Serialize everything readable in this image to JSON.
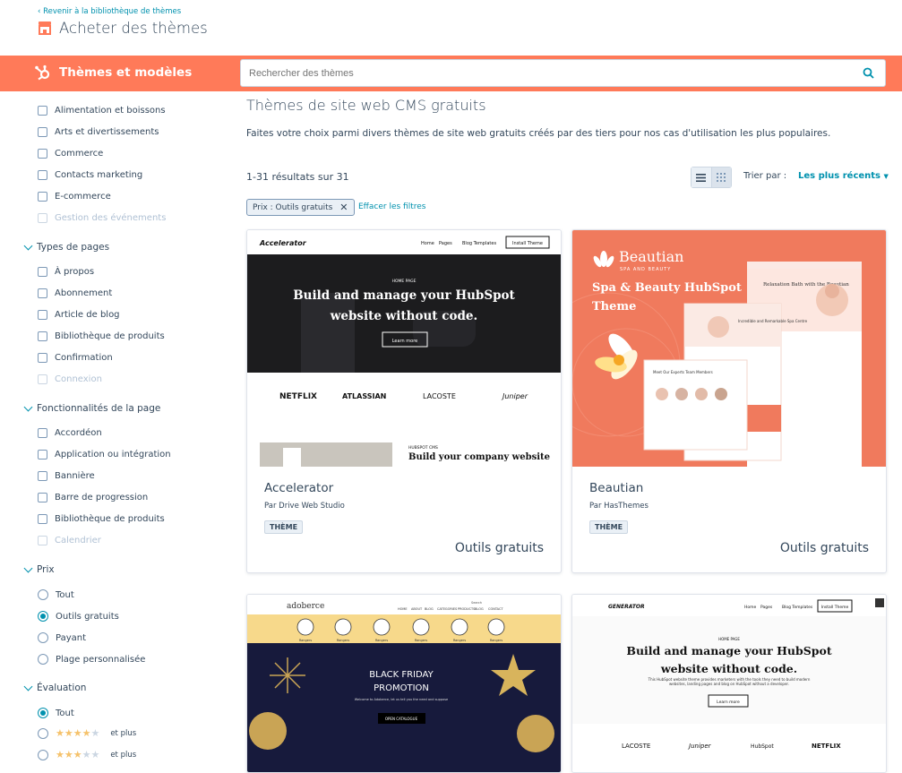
{
  "header": {
    "back_link": "Revenir à la bibliothèque de thèmes",
    "title": "Acheter des thèmes"
  },
  "band": {
    "title": "Thèmes et modèles"
  },
  "search": {
    "placeholder": "Rechercher des thèmes"
  },
  "sidebar": {
    "categories": [
      {
        "label": "Alimentation et boissons",
        "disabled": false
      },
      {
        "label": "Arts et divertissements",
        "disabled": false
      },
      {
        "label": "Commerce",
        "disabled": false
      },
      {
        "label": "Contacts marketing",
        "disabled": false
      },
      {
        "label": "E-commerce",
        "disabled": false
      },
      {
        "label": "Gestion des événements",
        "disabled": true
      }
    ],
    "page_types_title": "Types de pages",
    "page_types": [
      "À propos",
      "Abonnement",
      "Article de blog",
      "Bibliothèque de produits",
      "Confirmation",
      "Connexion"
    ],
    "features_title": "Fonctionnalités de la page",
    "features": [
      "Accordéon",
      "Application ou intégration",
      "Bannière",
      "Barre de progression",
      "Bibliothèque de produits",
      "Calendrier"
    ],
    "price_title": "Prix",
    "price_options": [
      "Tout",
      "Outils gratuits",
      "Payant",
      "Plage personnalisée"
    ],
    "price_selected": 1,
    "rating_title": "Évaluation",
    "rating_all": "Tout",
    "rating_suffix": "et plus",
    "rating_rows": [
      4,
      3
    ]
  },
  "main": {
    "title": "Thèmes de site web CMS gratuits",
    "description": "Faites votre choix parmi divers thèmes de site web gratuits créés par des tiers pour nos cas d'utilisation les plus populaires.",
    "results": "1-31 résultats sur 31",
    "sort_label": "Trier par :",
    "sort_value": "Les plus récents",
    "filter_chip": "Prix : Outils gratuits",
    "clear_filters": "Effacer les filtres"
  },
  "cards": [
    {
      "name": "Accelerator",
      "author": "Par Drive Web Studio",
      "tag": "THÈME",
      "price": "Outils gratuits",
      "thumb": {
        "logo": "Accelerator",
        "nav": [
          "Home",
          "Pages",
          "Blog Templates"
        ],
        "cta": "Install Theme",
        "eyebrow": "HOME PAGE",
        "headline1": "Build and manage your HubSpot",
        "headline2": "website without code.",
        "button": "Learn more",
        "brands": [
          "NETFLIX",
          "ATLASSIAN",
          "LACOSTE",
          "Juniper"
        ],
        "sub_eyebrow": "HUBSPOT CMS",
        "sub_headline": "Build your company website"
      }
    },
    {
      "name": "Beautian",
      "author": "Par HasThemes",
      "tag": "THÈME",
      "price": "Outils gratuits",
      "thumb": {
        "logo": "Beautian",
        "logo_sub": "SPA AND BEAUTY",
        "headline1": "Spa & Beauty HubSpot",
        "headline2": "Theme",
        "mock1": "Relaxation Bath with the Beautian",
        "mock2": "Meet Our Experts Team Members",
        "mock3": "Incredible and Remarkable Spa Centre"
      }
    },
    {
      "name": "",
      "author": "",
      "tag": "",
      "price": "",
      "thumb": {
        "logo": "adoberce",
        "nav": [
          "HOME",
          "ABOUT",
          "BLOG",
          "CATEGORIES",
          "PRODUCTS",
          "BLOG",
          "CONTACT"
        ],
        "search": "Search",
        "icon_label": "Rangers",
        "headline1": "BLACK FRIDAY",
        "headline2": "PROMOTION",
        "subtitle": "Welcome to Adoberce, let us tell you the need and suppose",
        "button": "OPEN CATALOGUE"
      }
    },
    {
      "name": "",
      "author": "",
      "tag": "",
      "price": "",
      "thumb": {
        "logo": "GENERATOR",
        "nav": [
          "Home",
          "Pages",
          "Blog Templates"
        ],
        "cta": "Install Theme",
        "eyebrow": "HOME PAGE",
        "headline1": "Build and manage your HubSpot",
        "headline2": "website without code.",
        "body": "This HubSpot website theme provides marketers with the tools they need to build modern websites, landing pages and blog on HubSpot without a developer.",
        "button": "Learn more",
        "brands": [
          "LACOSTE",
          "Juniper",
          "HubSpot",
          "NETFLIX"
        ]
      }
    }
  ],
  "colors": {
    "accent": "#ff7a59",
    "link": "#0091ae",
    "text": "#33475b"
  }
}
